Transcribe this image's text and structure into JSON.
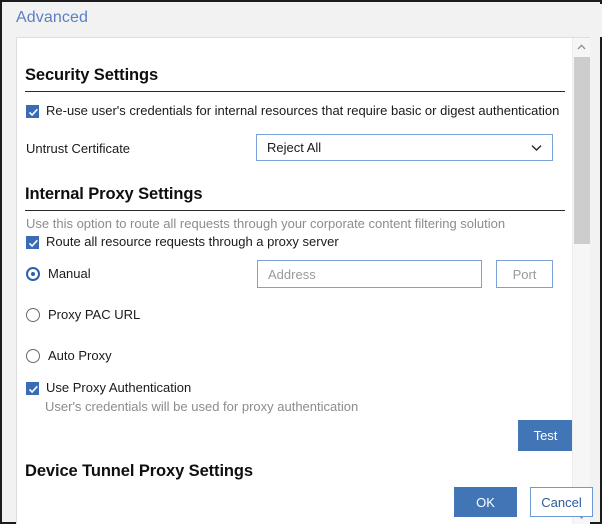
{
  "window": {
    "title": "Advanced"
  },
  "sections": {
    "security": {
      "heading": "Security Settings",
      "reuse_credentials": {
        "label": "Re-use user's credentials for internal resources that require basic or digest authentication",
        "checked": true
      },
      "untrust_certificate": {
        "label": "Untrust Certificate",
        "value": "Reject All",
        "chevron": "chevron-down-icon"
      }
    },
    "internal_proxy": {
      "heading": "Internal Proxy Settings",
      "description": "Use this option to route all requests through your corporate content filtering solution",
      "route_all": {
        "label": "Route all resource requests through a proxy server",
        "checked": true
      },
      "mode_options": [
        {
          "label": "Manual",
          "selected": true
        },
        {
          "label": "Proxy PAC URL",
          "selected": false
        },
        {
          "label": "Auto Proxy",
          "selected": false
        }
      ],
      "address_field": {
        "placeholder": "Address",
        "value": ""
      },
      "port_field": {
        "placeholder": "Port",
        "value": ""
      },
      "use_proxy_auth": {
        "label": "Use Proxy Authentication",
        "description": "User's credentials will be used for proxy authentication",
        "checked": true
      },
      "test_button": "Test"
    },
    "device_tunnel": {
      "heading": "Device Tunnel Proxy Settings"
    }
  },
  "footer": {
    "ok_label": "OK",
    "cancel_label": "Cancel"
  },
  "scrollbar": {
    "up_icon": "chevron-up-icon",
    "down_icon": "chevron-down-icon"
  },
  "colors": {
    "accent": "#4175b5",
    "title": "#5b7fc0",
    "field_border": "#7ba1d6",
    "muted_text": "#8c8c8c"
  }
}
